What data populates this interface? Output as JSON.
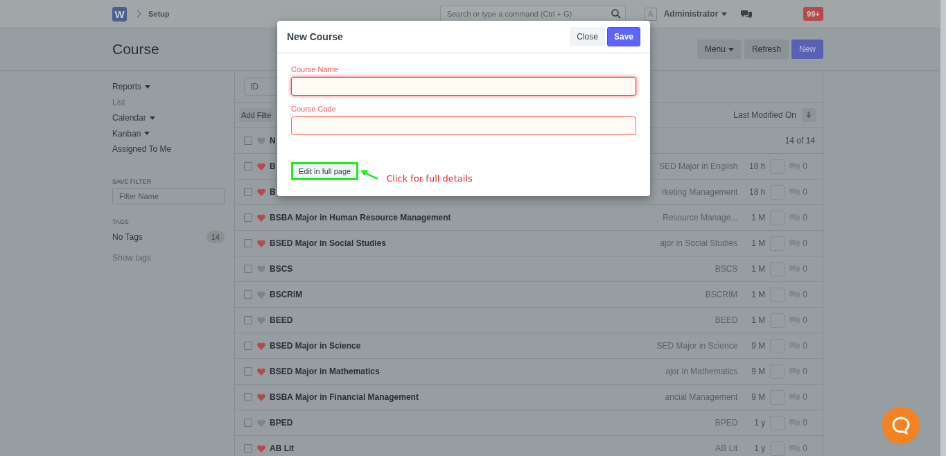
{
  "topbar": {
    "logo": "W",
    "breadcrumb": "Setup",
    "search_placeholder": "Search or type a command (Ctrl + G)",
    "avatar": "A",
    "user": "Administrator",
    "notifications": "99+"
  },
  "page": {
    "title": "Course",
    "buttons": [
      {
        "label": "Menu",
        "kind": "dropdown"
      },
      {
        "label": "Refresh",
        "kind": "default"
      },
      {
        "label": "New",
        "kind": "primary"
      }
    ]
  },
  "sidebar": {
    "items": [
      {
        "label": "Reports",
        "dropdown": true,
        "disabled": false
      },
      {
        "label": "List",
        "dropdown": false,
        "disabled": true
      },
      {
        "label": "Calendar",
        "dropdown": true,
        "disabled": false
      },
      {
        "label": "Kanban",
        "dropdown": true,
        "disabled": false
      },
      {
        "label": "Assigned To Me",
        "dropdown": false,
        "disabled": false
      }
    ],
    "save_filter": {
      "heading": "SAVE FILTER",
      "placeholder": "Filter Name"
    },
    "tags": {
      "heading": "TAGS",
      "items": [
        {
          "label": "No Tags",
          "count": "14"
        }
      ],
      "show_tags": "Show tags"
    }
  },
  "list": {
    "id_placeholder": "ID",
    "add_filter": "Add Filte",
    "sort_label": "Last Modified On",
    "header": {
      "title": "N",
      "checked": false,
      "liked": false,
      "count": "14 of 14"
    },
    "rows": [
      {
        "title": "B",
        "checked": false,
        "liked": true,
        "subtitle": "SED Major in English",
        "modified": "18 h",
        "comments": "0"
      },
      {
        "title": "B",
        "checked": false,
        "liked": true,
        "subtitle": "rketing Management",
        "modified": "18 h",
        "comments": "0"
      },
      {
        "title": "BSBA Major in Human Resource Management",
        "checked": false,
        "liked": true,
        "subtitle": "Resource Manage...",
        "modified": "1 M",
        "comments": "0"
      },
      {
        "title": "BSED Major in Social Studies",
        "checked": false,
        "liked": true,
        "subtitle": "ajor in Social Studies",
        "modified": "1 M",
        "comments": "0"
      },
      {
        "title": "BSCS",
        "checked": false,
        "liked": false,
        "subtitle": "BSCS",
        "modified": "1 M",
        "comments": "0"
      },
      {
        "title": "BSCRIM",
        "checked": false,
        "liked": false,
        "subtitle": "BSCRIM",
        "modified": "1 M",
        "comments": "0"
      },
      {
        "title": "BEED",
        "checked": false,
        "liked": false,
        "subtitle": "BEED",
        "modified": "1 M",
        "comments": "0"
      },
      {
        "title": "BSED Major in Science",
        "checked": false,
        "liked": true,
        "subtitle": "SED Major in Science",
        "modified": "9 M",
        "comments": "0"
      },
      {
        "title": "BSED Major in Mathematics",
        "checked": false,
        "liked": true,
        "subtitle": "ajor in Mathematics",
        "modified": "9 M",
        "comments": "0"
      },
      {
        "title": "BSBA Major in Financial Management",
        "checked": false,
        "liked": true,
        "subtitle": "ancial Management",
        "modified": "9 M",
        "comments": "0"
      },
      {
        "title": "BPED",
        "checked": false,
        "liked": false,
        "subtitle": "BPED",
        "modified": "1 y",
        "comments": "0"
      },
      {
        "title": "AB Lit",
        "checked": false,
        "liked": true,
        "subtitle": "AB Lit",
        "modified": "1 y",
        "comments": "0"
      }
    ]
  },
  "modal": {
    "title": "New Course",
    "close": "Close",
    "save": "Save",
    "fields": [
      {
        "label": "Course Name",
        "required": true,
        "focused": true
      },
      {
        "label": "Course Code",
        "required": true,
        "focused": false
      }
    ],
    "edit_full_page": "Edit in full page",
    "annotation": "Click for full details"
  }
}
